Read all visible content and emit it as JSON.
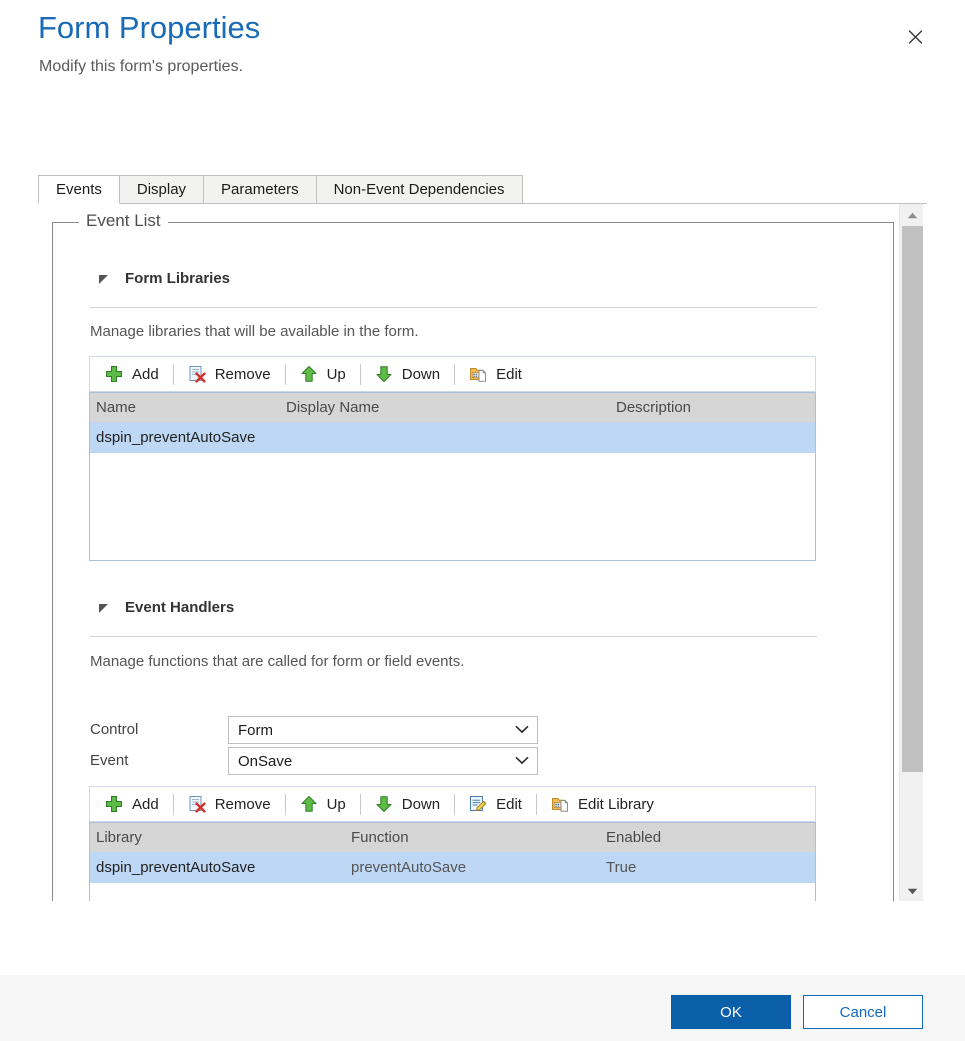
{
  "header": {
    "title": "Form Properties",
    "subtitle": "Modify this form's properties.",
    "close_icon": "close-icon"
  },
  "tabs": [
    {
      "label": "Events",
      "selected": true
    },
    {
      "label": "Display",
      "selected": false
    },
    {
      "label": "Parameters",
      "selected": false
    },
    {
      "label": "Non-Event Dependencies",
      "selected": false
    }
  ],
  "groupbox": {
    "legend": "Event List"
  },
  "form_libraries": {
    "section_title": "Form Libraries",
    "collapse_icon": "collapse-triangle-icon",
    "description": "Manage libraries that will be available in the form.",
    "toolbar": [
      {
        "label": "Add",
        "icon": "add-plus-icon"
      },
      {
        "label": "Remove",
        "icon": "remove-document-x-icon"
      },
      {
        "label": "Up",
        "icon": "arrow-up-icon"
      },
      {
        "label": "Down",
        "icon": "arrow-down-icon"
      },
      {
        "label": "Edit",
        "icon": "edit-library-icon"
      }
    ],
    "columns": [
      "Name",
      "Display Name",
      "Description"
    ],
    "rows": [
      {
        "name": "dspin_preventAutoSave",
        "display_name": "",
        "description": "",
        "selected": true
      }
    ]
  },
  "event_handlers": {
    "section_title": "Event Handlers",
    "collapse_icon": "collapse-triangle-icon",
    "description": "Manage functions that are called for form or field events.",
    "control_label": "Control",
    "control_value": "Form",
    "event_label": "Event",
    "event_value": "OnSave",
    "toolbar": [
      {
        "label": "Add",
        "icon": "add-plus-icon"
      },
      {
        "label": "Remove",
        "icon": "remove-document-x-icon"
      },
      {
        "label": "Up",
        "icon": "arrow-up-icon"
      },
      {
        "label": "Down",
        "icon": "arrow-down-icon"
      },
      {
        "label": "Edit",
        "icon": "edit-pencil-icon"
      },
      {
        "label": "Edit Library",
        "icon": "edit-library-icon"
      }
    ],
    "columns": [
      "Library",
      "Function",
      "Enabled"
    ],
    "rows": [
      {
        "library": "dspin_preventAutoSave",
        "function": "preventAutoSave",
        "enabled": "True",
        "selected": true
      }
    ]
  },
  "scrollbar": {
    "up_icon": "scroll-up-arrow-icon",
    "down_icon": "scroll-down-arrow-icon"
  },
  "footer": {
    "ok_label": "OK",
    "cancel_label": "Cancel"
  },
  "colors": {
    "title_blue": "#1a6bb5",
    "primary_button": "#0b5ea8",
    "link_blue": "#1268bd",
    "row_selected": "#bdd7f5",
    "grid_header": "#d6d6d6",
    "grid_border": "#a9c0de"
  }
}
